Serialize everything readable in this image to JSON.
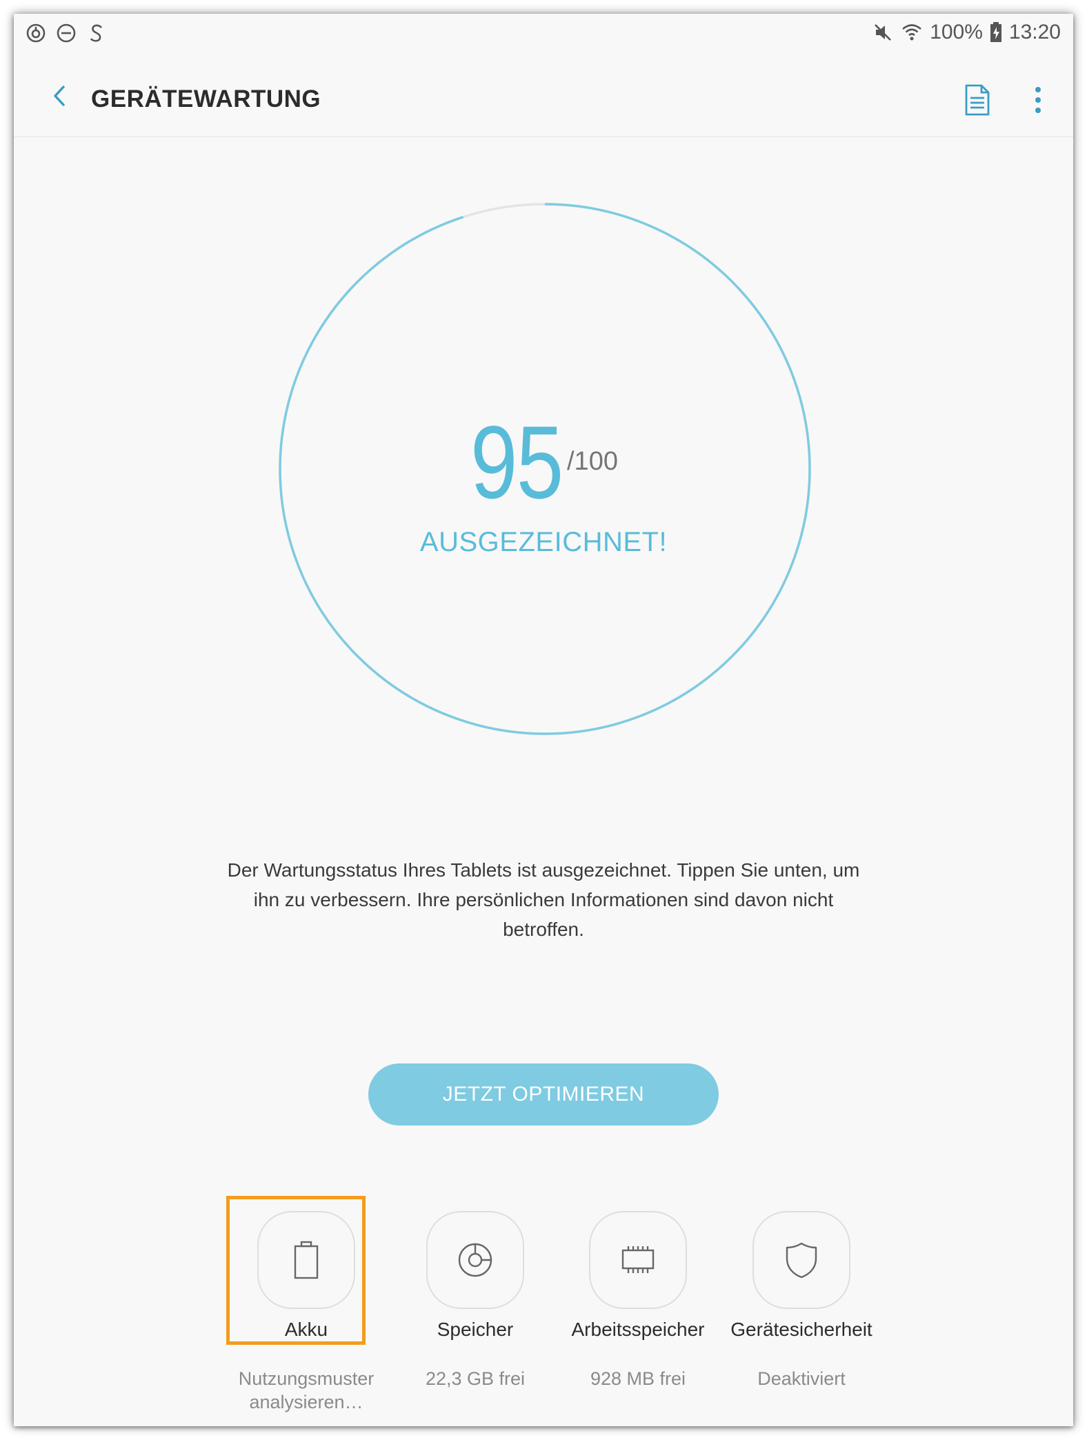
{
  "status_bar": {
    "battery_percent": "100%",
    "time": "13:20",
    "left_icons": [
      "sync-icon",
      "do-not-disturb-icon",
      "s-app-icon"
    ],
    "right_icons": [
      "mute-icon",
      "wifi-icon",
      "battery-charging-icon"
    ]
  },
  "app_bar": {
    "title": "GERÄTEWARTUNG",
    "back_icon": "chevron-left-icon",
    "actions": [
      "report-icon",
      "more-vert-icon"
    ]
  },
  "score": {
    "value": "95",
    "max_label": "/100",
    "fraction": 0.95,
    "status": "AUSGEZEICHNET!"
  },
  "description": "Der Wartungsstatus Ihres Tablets ist ausgezeichnet. Tippen Sie unten, um ihn zu verbessern. Ihre persönlichen Informationen sind davon nicht betroffen.",
  "optimize_button": {
    "label": "JETZT OPTIMIEREN"
  },
  "tiles": [
    {
      "label": "Akku",
      "sub": "Nutzungsmuster analysieren…",
      "icon": "battery-icon"
    },
    {
      "label": "Speicher",
      "sub": "22,3 GB frei",
      "icon": "storage-pie-icon"
    },
    {
      "label": "Arbeitsspeicher",
      "sub": "928 MB frei",
      "icon": "memory-chip-icon"
    },
    {
      "label": "Gerätesicherheit",
      "sub": "Deaktiviert",
      "icon": "shield-icon"
    }
  ],
  "colors": {
    "accent": "#58bcd9",
    "button": "#7fcbe1",
    "ring_track": "#e4e4e4",
    "highlight": "#f39c1e"
  }
}
